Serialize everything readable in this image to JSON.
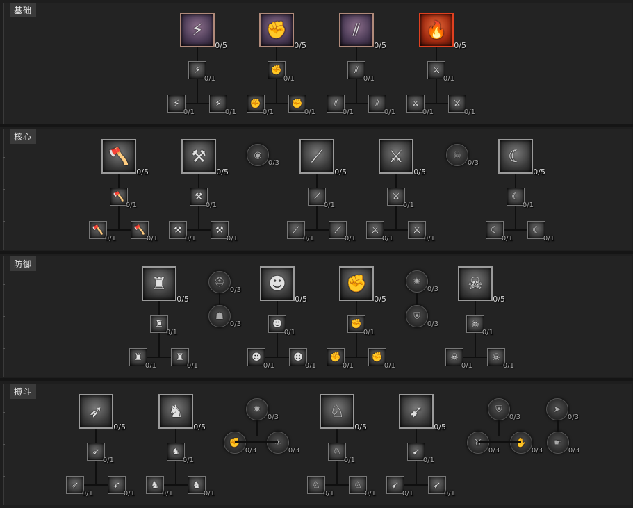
{
  "sections": [
    {
      "label": "基础",
      "clusters": [
        {
          "base": {
            "icon": "lightning-sword-icon",
            "glyph": "⚡",
            "rank": "0/5",
            "style": "purple"
          },
          "upgrade": {
            "icon": "lightning-sword-icon",
            "glyph": "⚡",
            "rank": "0/1"
          },
          "choices": [
            {
              "icon": "lightning-sword-icon",
              "glyph": "⚡",
              "rank": "0/1"
            },
            {
              "icon": "lightning-sword-icon",
              "glyph": "⚡",
              "rank": "0/1"
            }
          ]
        },
        {
          "base": {
            "icon": "fist-icon",
            "glyph": "✊",
            "rank": "0/5",
            "style": "purple"
          },
          "upgrade": {
            "icon": "fist-icon",
            "glyph": "✊",
            "rank": "0/1"
          },
          "choices": [
            {
              "icon": "fist-icon",
              "glyph": "✊",
              "rank": "0/1"
            },
            {
              "icon": "fist-icon",
              "glyph": "✊",
              "rank": "0/1"
            }
          ]
        },
        {
          "base": {
            "icon": "claw-slash-icon",
            "glyph": "⫽",
            "rank": "0/5",
            "style": "purple"
          },
          "upgrade": {
            "icon": "claw-slash-icon",
            "glyph": "⫽",
            "rank": "0/1"
          },
          "choices": [
            {
              "icon": "claw-slash-icon",
              "glyph": "⫽",
              "rank": "0/1"
            },
            {
              "icon": "claw-slash-icon",
              "glyph": "⫽",
              "rank": "0/1"
            }
          ]
        },
        {
          "base": {
            "icon": "flame-weapon-icon",
            "glyph": "🔥",
            "rank": "0/5",
            "style": "red"
          },
          "upgrade": {
            "icon": "flame-weapon-icon",
            "glyph": "⚔",
            "rank": "0/1"
          },
          "choices": [
            {
              "icon": "flame-weapon-icon",
              "glyph": "⚔",
              "rank": "0/1"
            },
            {
              "icon": "flame-weapon-icon",
              "glyph": "⚔",
              "rank": "0/1"
            }
          ]
        }
      ],
      "passives": []
    },
    {
      "label": "核心",
      "clusters": [
        {
          "base": {
            "icon": "whirlwind-axe-icon",
            "glyph": "🪓",
            "rank": "0/5"
          },
          "upgrade": {
            "icon": "whirlwind-axe-icon",
            "glyph": "🪓",
            "rank": "0/1"
          },
          "choices": [
            {
              "icon": "whirlwind-axe-icon",
              "glyph": "🪓",
              "rank": "0/1"
            },
            {
              "icon": "whirlwind-axe-icon",
              "glyph": "🪓",
              "rank": "0/1"
            }
          ]
        },
        {
          "base": {
            "icon": "hammer-strike-icon",
            "glyph": "⚒",
            "rank": "0/5"
          },
          "upgrade": {
            "icon": "hammer-strike-icon",
            "glyph": "⚒",
            "rank": "0/1"
          },
          "choices": [
            {
              "icon": "hammer-strike-icon",
              "glyph": "⚒",
              "rank": "0/1"
            },
            {
              "icon": "hammer-strike-icon",
              "glyph": "⚒",
              "rank": "0/1"
            }
          ]
        },
        {
          "base": {
            "icon": "blade-rend-icon",
            "glyph": "⟋",
            "rank": "0/5"
          },
          "upgrade": {
            "icon": "blade-rend-icon",
            "glyph": "⟋",
            "rank": "0/1"
          },
          "choices": [
            {
              "icon": "blade-rend-icon",
              "glyph": "⟋",
              "rank": "0/1"
            },
            {
              "icon": "blade-rend-icon",
              "glyph": "⟋",
              "rank": "0/1"
            }
          ]
        },
        {
          "base": {
            "icon": "crossed-axes-icon",
            "glyph": "⚔",
            "rank": "0/5"
          },
          "upgrade": {
            "icon": "crossed-axes-icon",
            "glyph": "⚔",
            "rank": "0/1"
          },
          "choices": [
            {
              "icon": "crossed-axes-icon",
              "glyph": "⚔",
              "rank": "0/1"
            },
            {
              "icon": "crossed-axes-icon",
              "glyph": "⚔",
              "rank": "0/1"
            }
          ]
        },
        {
          "base": {
            "icon": "crescent-slash-icon",
            "glyph": "☾",
            "rank": "0/5"
          },
          "upgrade": {
            "icon": "crescent-slash-icon",
            "glyph": "☾",
            "rank": "0/1"
          },
          "choices": [
            {
              "icon": "crescent-slash-icon",
              "glyph": "☾",
              "rank": "0/1"
            },
            {
              "icon": "crescent-slash-icon",
              "glyph": "☾",
              "rank": "0/1"
            }
          ]
        }
      ],
      "passives": [
        {
          "icon": "eye-sigil-icon",
          "glyph": "◉",
          "rank": "0/3"
        },
        {
          "icon": "skull-sigil-icon",
          "glyph": "☠",
          "rank": "0/3"
        }
      ]
    },
    {
      "label": "防御",
      "clusters": [
        {
          "base": {
            "icon": "war-horn-icon",
            "glyph": "♜",
            "rank": "0/5"
          },
          "upgrade": {
            "icon": "war-horn-icon",
            "glyph": "♜",
            "rank": "0/1"
          },
          "choices": [
            {
              "icon": "war-horn-icon",
              "glyph": "♜",
              "rank": "0/1"
            },
            {
              "icon": "war-horn-icon",
              "glyph": "♜",
              "rank": "0/1"
            }
          ]
        },
        {
          "base": {
            "icon": "demon-face-icon",
            "glyph": "☻",
            "rank": "0/5"
          },
          "upgrade": {
            "icon": "demon-face-icon",
            "glyph": "☻",
            "rank": "0/1"
          },
          "choices": [
            {
              "icon": "demon-face-icon",
              "glyph": "☻",
              "rank": "0/1"
            },
            {
              "icon": "demon-face-icon",
              "glyph": "☻",
              "rank": "0/1"
            }
          ]
        },
        {
          "base": {
            "icon": "shield-fist-icon",
            "glyph": "✊",
            "rank": "0/5"
          },
          "upgrade": {
            "icon": "shield-fist-icon",
            "glyph": "✊",
            "rank": "0/1"
          },
          "choices": [
            {
              "icon": "shield-fist-icon",
              "glyph": "✊",
              "rank": "0/1"
            },
            {
              "icon": "shield-fist-icon",
              "glyph": "✊",
              "rank": "0/1"
            }
          ]
        },
        {
          "base": {
            "icon": "skull-banner-icon",
            "glyph": "☠",
            "rank": "0/5"
          },
          "upgrade": {
            "icon": "skull-banner-icon",
            "glyph": "☠",
            "rank": "0/1"
          },
          "choices": [
            {
              "icon": "skull-banner-icon",
              "glyph": "☠",
              "rank": "0/1"
            },
            {
              "icon": "skull-banner-icon",
              "glyph": "☠",
              "rank": "0/1"
            }
          ]
        }
      ],
      "passives": [
        {
          "icon": "helmet-sigil-icon",
          "glyph": "⛑",
          "rank": "0/3"
        },
        {
          "icon": "beast-sigil-icon",
          "glyph": "☗",
          "rank": "0/3"
        },
        {
          "icon": "wheel-sigil-icon",
          "glyph": "✺",
          "rank": "0/3"
        },
        {
          "icon": "shield-sigil-icon",
          "glyph": "⛨",
          "rank": "0/3"
        }
      ]
    },
    {
      "label": "搏斗",
      "clusters": [
        {
          "base": {
            "icon": "charge-icon",
            "glyph": "➶",
            "rank": "0/5"
          },
          "upgrade": {
            "icon": "charge-icon",
            "glyph": "➶",
            "rank": "0/1"
          },
          "choices": [
            {
              "icon": "charge-icon",
              "glyph": "➶",
              "rank": "0/1"
            },
            {
              "icon": "charge-icon",
              "glyph": "➶",
              "rank": "0/1"
            }
          ]
        },
        {
          "base": {
            "icon": "horned-head-icon",
            "glyph": "♞",
            "rank": "0/5"
          },
          "upgrade": {
            "icon": "horned-head-icon",
            "glyph": "♞",
            "rank": "0/1"
          },
          "choices": [
            {
              "icon": "horned-head-icon",
              "glyph": "♞",
              "rank": "0/1"
            },
            {
              "icon": "horned-head-icon",
              "glyph": "♞",
              "rank": "0/1"
            }
          ]
        },
        {
          "base": {
            "icon": "roaring-beast-icon",
            "glyph": "♘",
            "rank": "0/5"
          },
          "upgrade": {
            "icon": "roaring-beast-icon",
            "glyph": "♘",
            "rank": "0/1"
          },
          "choices": [
            {
              "icon": "roaring-beast-icon",
              "glyph": "♘",
              "rank": "0/1"
            },
            {
              "icon": "roaring-beast-icon",
              "glyph": "♘",
              "rank": "0/1"
            }
          ]
        },
        {
          "base": {
            "icon": "leap-slam-icon",
            "glyph": "➹",
            "rank": "0/5"
          },
          "upgrade": {
            "icon": "leap-slam-icon",
            "glyph": "➹",
            "rank": "0/1"
          },
          "choices": [
            {
              "icon": "leap-slam-icon",
              "glyph": "➹",
              "rank": "0/1"
            },
            {
              "icon": "leap-slam-icon",
              "glyph": "➹",
              "rank": "0/1"
            }
          ]
        }
      ],
      "passives": [
        {
          "icon": "spiked-sigil-icon",
          "glyph": "✹",
          "rank": "0/3"
        },
        {
          "icon": "fist-sigil-icon",
          "glyph": "✊",
          "rank": "0/3"
        },
        {
          "icon": "claw-sigil-icon",
          "glyph": "✶",
          "rank": "0/3"
        },
        {
          "icon": "shield-crest-sigil-icon",
          "glyph": "⛨",
          "rank": "0/3"
        },
        {
          "icon": "boar-sigil-icon",
          "glyph": "♉",
          "rank": "0/3"
        },
        {
          "icon": "gauntlet-sigil-icon",
          "glyph": "✋",
          "rank": "0/3"
        },
        {
          "icon": "charge-sigil-icon",
          "glyph": "➤",
          "rank": "0/3"
        },
        {
          "icon": "hand-sigil-icon",
          "glyph": "☛",
          "rank": "0/3"
        }
      ]
    }
  ]
}
